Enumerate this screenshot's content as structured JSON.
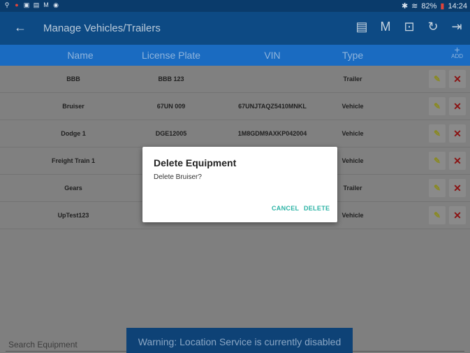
{
  "status_bar": {
    "left_icons": [
      "location-icon",
      "alert-icon",
      "image-icon",
      "storage-icon",
      "gmail-icon",
      "chrome-icon"
    ],
    "left_glyphs": [
      "⚲",
      "●",
      "▣",
      "▤",
      "M",
      "◉"
    ],
    "bluetooth": "✱",
    "wifi": "≋",
    "battery_percent": "82%",
    "battery_icon": "▮",
    "time": "14:24"
  },
  "app_bar": {
    "back_glyph": "←",
    "title": "Manage Vehicles/Trailers",
    "icons": [
      {
        "name": "message-icon",
        "glyph": "▤"
      },
      {
        "name": "m-icon",
        "glyph": "M"
      },
      {
        "name": "inspection-icon",
        "glyph": "⊡"
      },
      {
        "name": "refresh-icon",
        "glyph": "↻"
      },
      {
        "name": "logout-icon",
        "glyph": "⇥"
      }
    ]
  },
  "table": {
    "headers": {
      "name": "Name",
      "license_plate": "License Plate",
      "vin": "VIN",
      "type": "Type"
    },
    "add_plus": "+",
    "add_label": "ADD",
    "rows": [
      {
        "name": "BBB",
        "plate": "BBB 123",
        "vin": "",
        "type": "Trailer"
      },
      {
        "name": "Bruiser",
        "plate": "67UN 009",
        "vin": "67UNJTAQZ5410MNKL",
        "type": "Vehicle"
      },
      {
        "name": "Dodge 1",
        "plate": "DGE12005",
        "vin": "1M8GDM9AXKP042004",
        "type": "Vehicle"
      },
      {
        "name": "Freight Train 1",
        "plate": "",
        "vin": "",
        "type": "Vehicle"
      },
      {
        "name": "Gears",
        "plate": "",
        "vin": "",
        "type": "Trailer"
      },
      {
        "name": "UpTest123",
        "plate": "",
        "vin": "",
        "type": "Vehicle"
      }
    ],
    "edit_glyph": "✎",
    "delete_glyph": "✕"
  },
  "search": {
    "placeholder": "Search Equipment"
  },
  "warning": "Warning: Location Service is currently disabled",
  "dialog": {
    "title": "Delete Equipment",
    "message": "Delete Bruiser?",
    "cancel": "CANCEL",
    "delete": "DELETE"
  }
}
